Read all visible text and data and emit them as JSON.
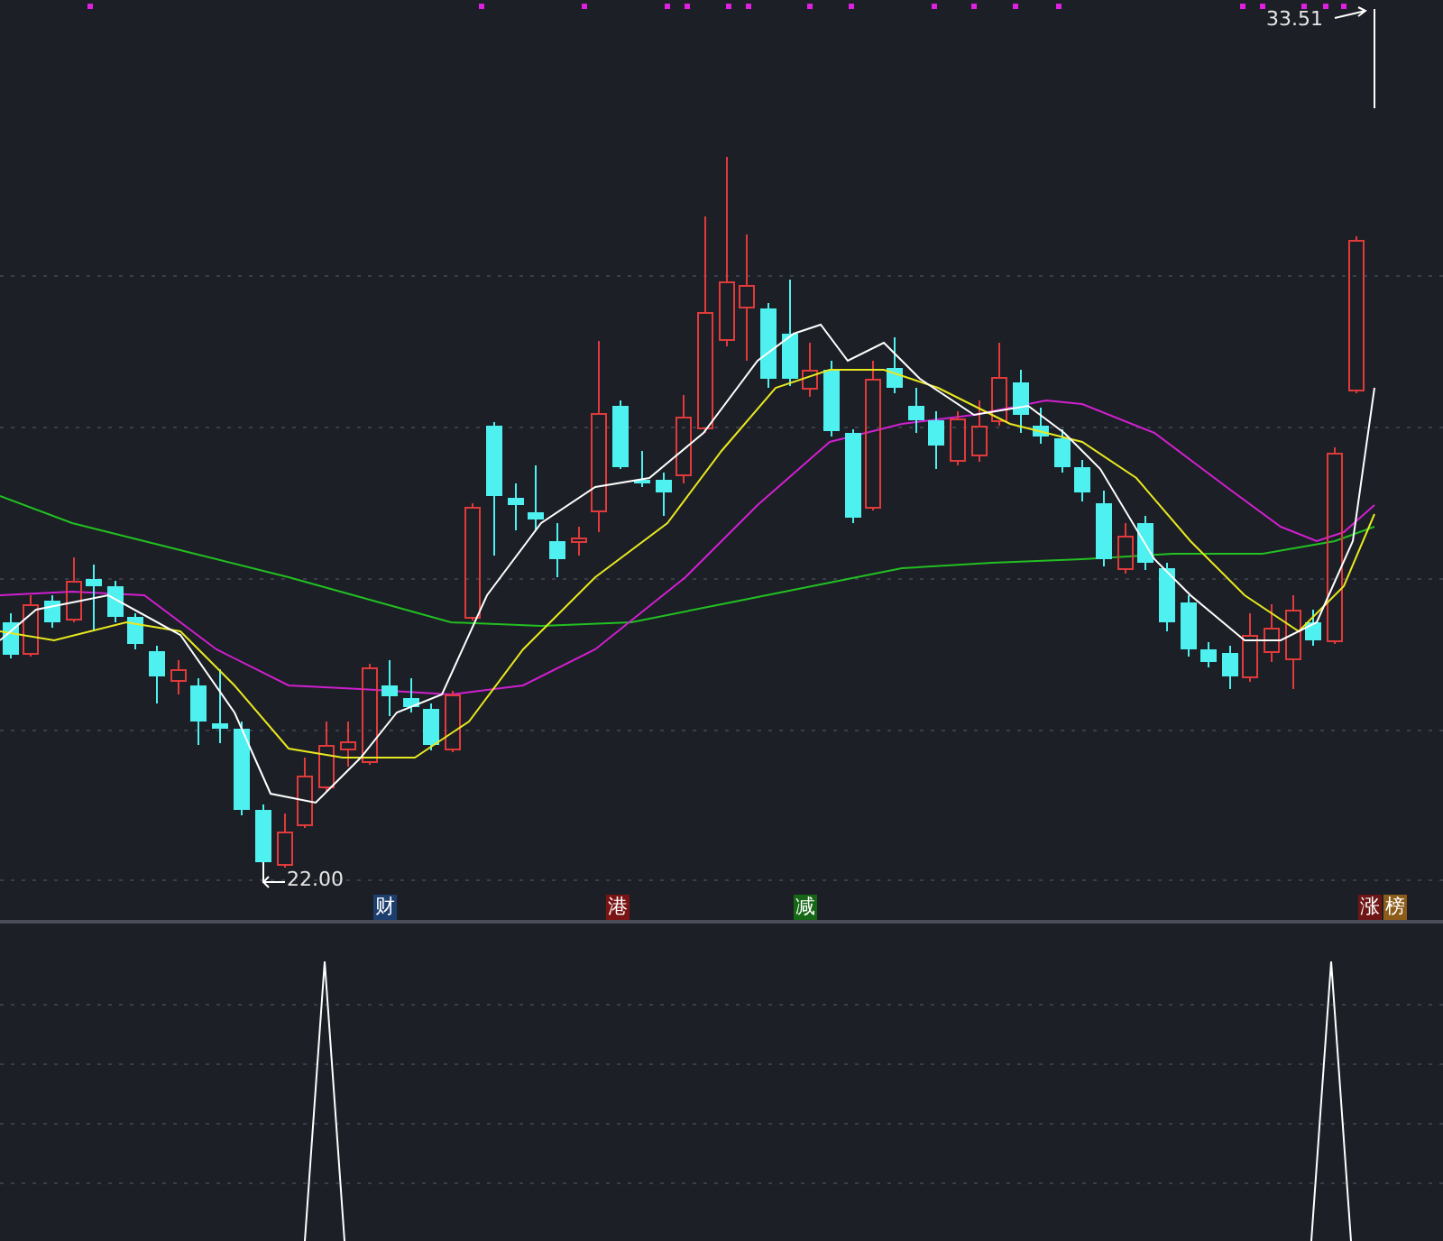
{
  "price_chart": {
    "high_label": "33.51",
    "low_label": "22.00",
    "markers": [
      {
        "text": "财",
        "color": "#1d3f6e"
      },
      {
        "text": "港",
        "color": "#7a1414"
      },
      {
        "text": "减",
        "color": "#156615"
      },
      {
        "text": "涨",
        "color": "#6e1616"
      },
      {
        "text": "榜",
        "color": "#8c5c18"
      }
    ]
  }
}
